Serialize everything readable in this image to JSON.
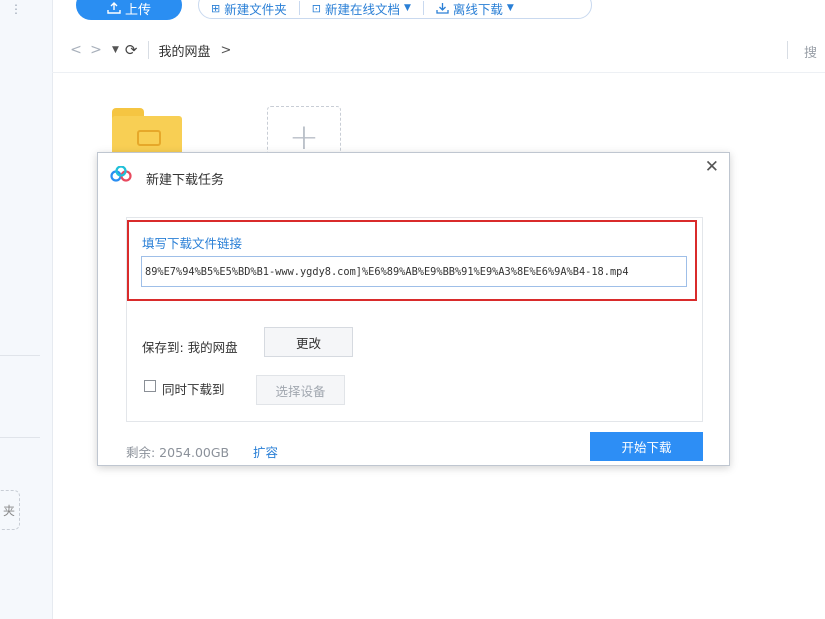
{
  "toolbar": {
    "upload_label": "上传",
    "new_folder_label": "新建文件夹",
    "new_online_doc_label": "新建在线文档",
    "offline_download_label": "离线下载"
  },
  "nav": {
    "breadcrumb_root": "我的网盘",
    "breadcrumb_arrow": ">",
    "search_placeholder": "搜"
  },
  "sidebar": {
    "new_folder_partial": "夹"
  },
  "dialog": {
    "title": "新建下载任务",
    "url_label": "填写下载文件链接",
    "url_value": "89%E7%94%B5%E5%BD%B1-www.ygdy8.com]%E6%89%AB%E9%BB%91%E9%A3%8E%E6%9A%B4-18.mp4",
    "save_to_label": "保存到: 我的网盘",
    "change_button": "更改",
    "sync_download_label": "同时下载到",
    "sync_download_checked": false,
    "select_device_button": "选择设备",
    "remaining_label": "剩余: 2054.00GB",
    "expand_link": "扩容",
    "start_button": "开始下载"
  },
  "colors": {
    "accent": "#2a8ef2",
    "link": "#2a7fd6",
    "highlight_border": "#d92b2b"
  }
}
